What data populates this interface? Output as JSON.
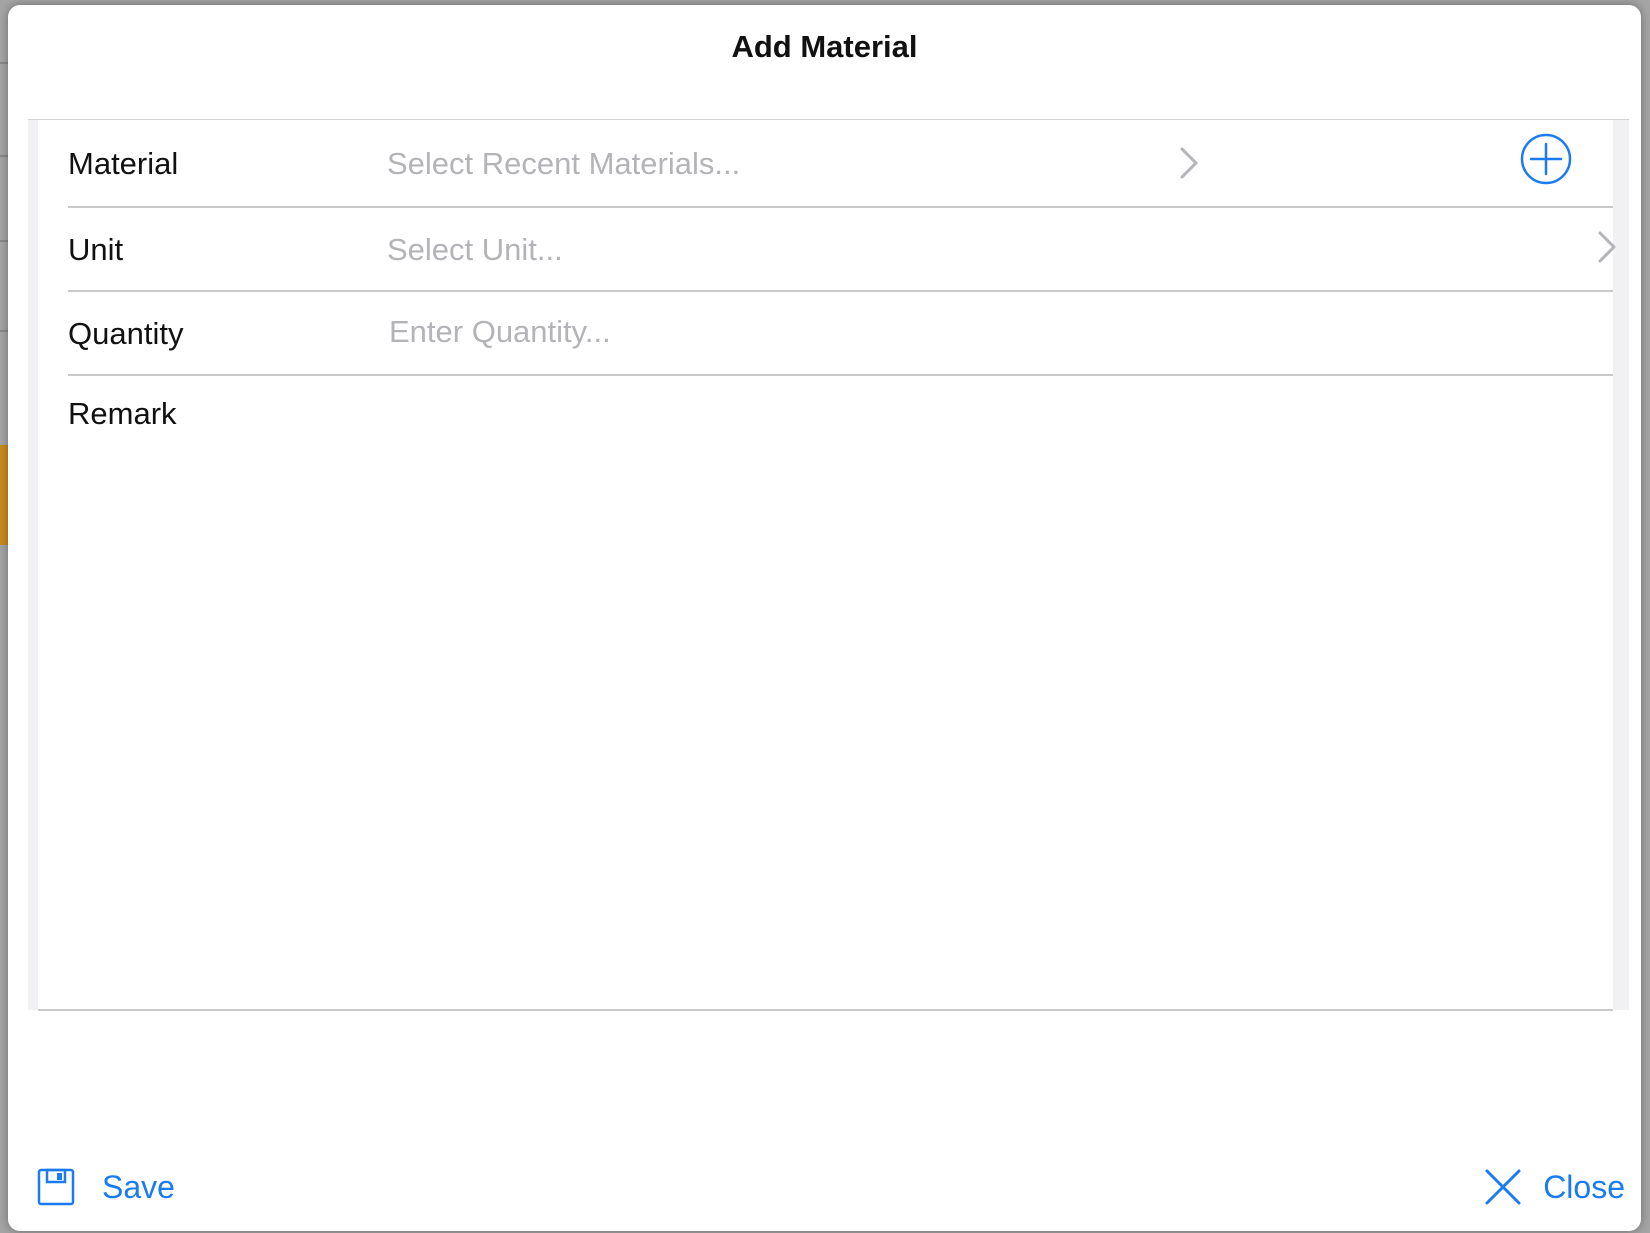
{
  "modal": {
    "title": "Add Material"
  },
  "form": {
    "material": {
      "label": "Material",
      "placeholder": "Select Recent Materials...",
      "chevron_icon": "chevron-right-icon",
      "add_icon": "plus-circle-icon"
    },
    "unit": {
      "label": "Unit",
      "placeholder": "Select Unit...",
      "chevron_icon": "chevron-right-icon"
    },
    "quantity": {
      "label": "Quantity",
      "placeholder": "Enter Quantity..."
    },
    "remark": {
      "label": "Remark",
      "value": ""
    }
  },
  "footer": {
    "save_label": "Save",
    "save_icon": "floppy-disk-icon",
    "close_label": "Close",
    "close_icon": "close-x-icon"
  },
  "colors": {
    "accent": "#1a7cf0",
    "placeholder": "#b4b4b8",
    "divider": "#c9c9cc",
    "text": "#111111"
  }
}
